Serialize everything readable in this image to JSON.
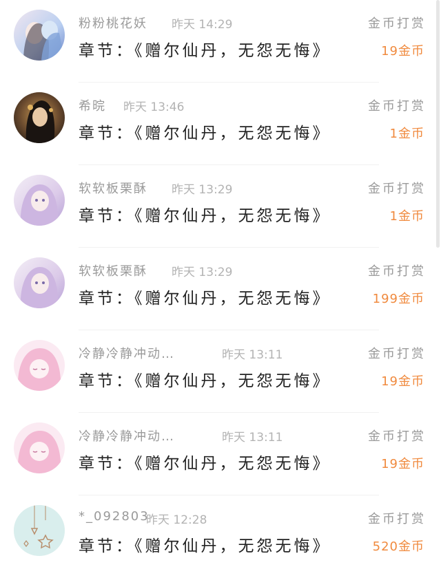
{
  "reward_label": "金币打赏",
  "chapter_text": "章节：《赠尔仙丹，无怨无悔》",
  "records": [
    {
      "name": "粉粉桃花妖",
      "time": "昨天  14:29",
      "amount": "19金币",
      "avatar_colors": [
        "#e9d7ea",
        "#a9c6ef",
        "#6f86c9"
      ]
    },
    {
      "name": "希晥",
      "time": "昨天  13:46",
      "amount": "1金币",
      "avatar_colors": [
        "#2a2019",
        "#c59752",
        "#6a4a2e"
      ]
    },
    {
      "name": "软软板栗酥",
      "time": "昨天  13:29",
      "amount": "1金币",
      "avatar_colors": [
        "#efe6f2",
        "#d7c3e5",
        "#b7a0d6"
      ]
    },
    {
      "name": "软软板栗酥",
      "time": "昨天  13:29",
      "amount": "199金币",
      "avatar_colors": [
        "#efe6f2",
        "#d7c3e5",
        "#b7a0d6"
      ]
    },
    {
      "name": "冷静冷静冲动…",
      "time": "昨天  13:11",
      "amount": "19金币",
      "avatar_colors": [
        "#fbe9f1",
        "#f4bdd6",
        "#ee9fc5"
      ]
    },
    {
      "name": "冷静冷静冲动…",
      "time": "昨天  13:11",
      "amount": "19金币",
      "avatar_colors": [
        "#fbe9f1",
        "#f4bdd6",
        "#ee9fc5"
      ]
    },
    {
      "name": "*_092803",
      "time": "昨天  12:28",
      "amount": "520金币",
      "avatar_colors": [
        "#dff1f0",
        "#a9d7d4",
        "#b88e6c"
      ]
    }
  ]
}
